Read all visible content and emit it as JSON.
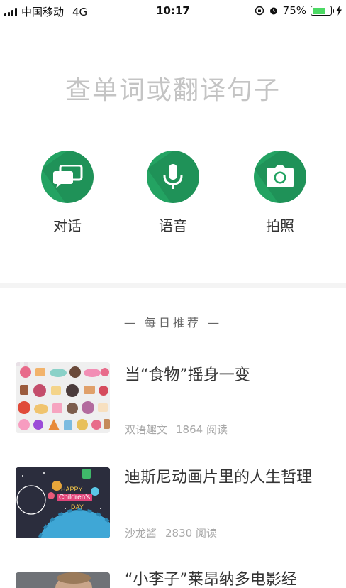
{
  "status_bar": {
    "carrier": "中国移动",
    "network": "4G",
    "time": "10:17",
    "battery_percent": "75%",
    "battery_level": 0.75
  },
  "search": {
    "placeholder": "查单词或翻译句子"
  },
  "actions": [
    {
      "label": "对话",
      "icon": "chat-bubbles-icon"
    },
    {
      "label": "语音",
      "icon": "microphone-icon"
    },
    {
      "label": "拍照",
      "icon": "camera-icon"
    }
  ],
  "section": {
    "title": "— 每日推荐 —"
  },
  "articles": [
    {
      "title": "当“食物”摇身一变",
      "category": "双语趣文",
      "reads": "1864 阅读"
    },
    {
      "title": "迪斯尼动画片里的人生哲理",
      "category": "沙龙酱",
      "reads": "2830 阅读",
      "thumb_text": [
        "HAPPY",
        "Children's",
        "DAY"
      ]
    },
    {
      "title": "“小李子”莱昂纳多电影经",
      "category": "",
      "reads": ""
    }
  ],
  "colors": {
    "accent": "#23a362",
    "battery": "#4cd964"
  }
}
